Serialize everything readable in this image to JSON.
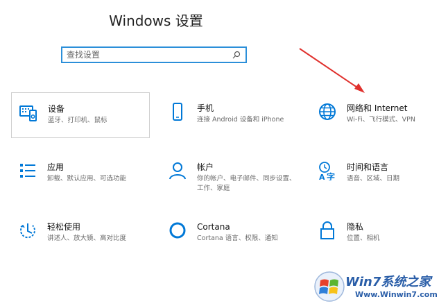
{
  "header": {
    "title": "Windows 设置"
  },
  "search": {
    "placeholder": "查找设置"
  },
  "colors": {
    "accent": "#0078d7",
    "arrow": "#e0302c",
    "watermark": "#2a5ea8"
  },
  "tiles": [
    {
      "title": "设备",
      "desc": "蓝牙、打印机、鼠标",
      "icon": "devices-icon"
    },
    {
      "title": "手机",
      "desc": "连接 Android 设备和 iPhone",
      "icon": "phone-icon"
    },
    {
      "title": "网络和 Internet",
      "desc": "Wi-Fi、飞行模式、VPN",
      "icon": "globe-icon"
    },
    {
      "title": "应用",
      "desc": "卸载、默认应用、可选功能",
      "icon": "apps-list-icon"
    },
    {
      "title": "帐户",
      "desc": "你的帐户、电子邮件、同步设置、工作、家庭",
      "icon": "person-icon"
    },
    {
      "title": "时间和语言",
      "desc": "语音、区域、日期",
      "icon": "time-language-icon"
    },
    {
      "title": "轻松使用",
      "desc": "讲述人、放大镜、高对比度",
      "icon": "ease-of-access-icon"
    },
    {
      "title": "Cortana",
      "desc": "Cortana 语言、权限、通知",
      "icon": "cortana-icon"
    },
    {
      "title": "隐私",
      "desc": "位置、相机",
      "icon": "lock-icon"
    }
  ],
  "watermark": {
    "text": "Win7系统之家",
    "url": "Www.Winwin7.com"
  }
}
